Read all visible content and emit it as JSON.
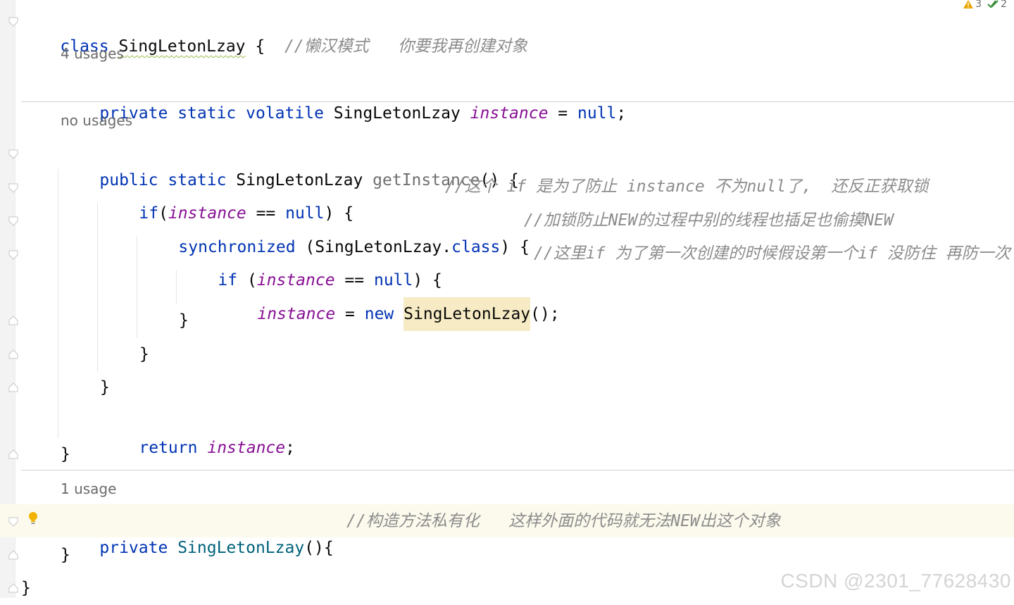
{
  "status": {
    "warnings": "3",
    "checks": "2"
  },
  "editor": {
    "l1": {
      "kw": "class",
      "name": "SingLetonLzay",
      "brace": "{",
      "comment": "//懒汉模式   你要我再创建对象"
    },
    "h1": "4 usages",
    "l2": {
      "kw1": "private",
      "kw2": "static",
      "kw3": "volatile",
      "type": "SingLetonLzay",
      "field": "instance",
      "eq": "=",
      "null": "null",
      "end": ";"
    },
    "h2": "no usages",
    "l3": {
      "kw1": "public",
      "kw2": "static",
      "type": "SingLetonLzay",
      "method": "getInstance",
      "rest": "() {"
    },
    "l4": {
      "kw": "if",
      "paren": "(",
      "field": "instance",
      "op": " == ",
      "null": "null",
      "rest": ") {",
      "comment": "//这个 if 是为了防止 instance 不为null了,  还反正获取锁"
    },
    "l5": {
      "kw": "synchronized",
      "mid": " (SingLetonLzay.",
      "kw2": "class",
      "rest": ") {",
      "comment": "//加锁防止NEW的过程中别的线程也插足也偷摸NEW"
    },
    "l6": {
      "kw": "if",
      "paren": " (",
      "field": "instance",
      "op": " == ",
      "null": "null",
      "rest": ") {",
      "comment": "//这里if 为了第一次创建的时候假设第一个if 没防住 再防一次"
    },
    "l7": {
      "field": "instance",
      "eq": " = ",
      "kw": "new",
      "type": "SingLetonLzay",
      "rest": "();"
    },
    "l8": "}",
    "l9": "}",
    "l10": "}",
    "l11": {
      "kw": "return",
      "field": "instance",
      "end": ";"
    },
    "l12": "}",
    "h3": "1 usage",
    "l13": {
      "kw": "private",
      "ctor": "SingLetonLzay",
      "rest": "(){",
      "comment": "//构造方法私有化   这样外面的代码就无法NEW出这个对象"
    },
    "l14": "}",
    "l15": "}"
  },
  "watermark": "CSDN @2301_77628430"
}
